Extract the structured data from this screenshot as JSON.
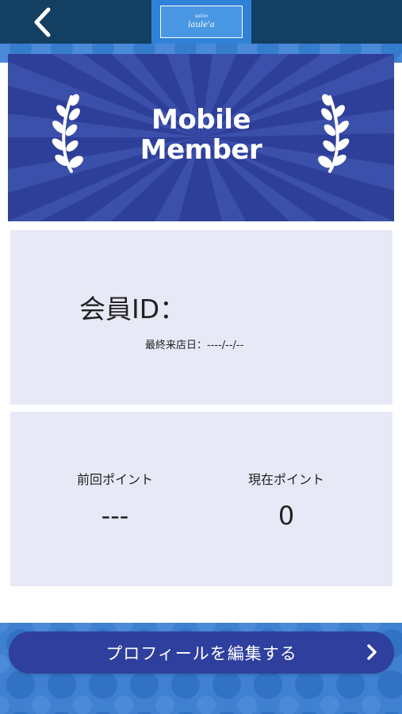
{
  "header": {
    "back_icon": "chevron-left-icon",
    "logo_small": "salon",
    "logo_main": "laule'a"
  },
  "hero": {
    "title_line1": "Mobile",
    "title_line2": "Member",
    "left_icon": "laurel-left-icon",
    "right_icon": "laurel-right-icon"
  },
  "member": {
    "id_label": "会員ID",
    "id_colon": "：",
    "last_visit": "最終来店日：----/--/--"
  },
  "points": {
    "previous_label": "前回ポイント",
    "previous_value": "---",
    "current_label": "現在ポイント",
    "current_value": "0"
  },
  "profile_button": {
    "label": "プロフィールを編集する",
    "icon": "chevron-right-icon"
  },
  "colors": {
    "topbar": "#133f62",
    "accent": "#2f3f9d",
    "pattern": "#3d7fcf",
    "card": "#e8e9f6"
  }
}
